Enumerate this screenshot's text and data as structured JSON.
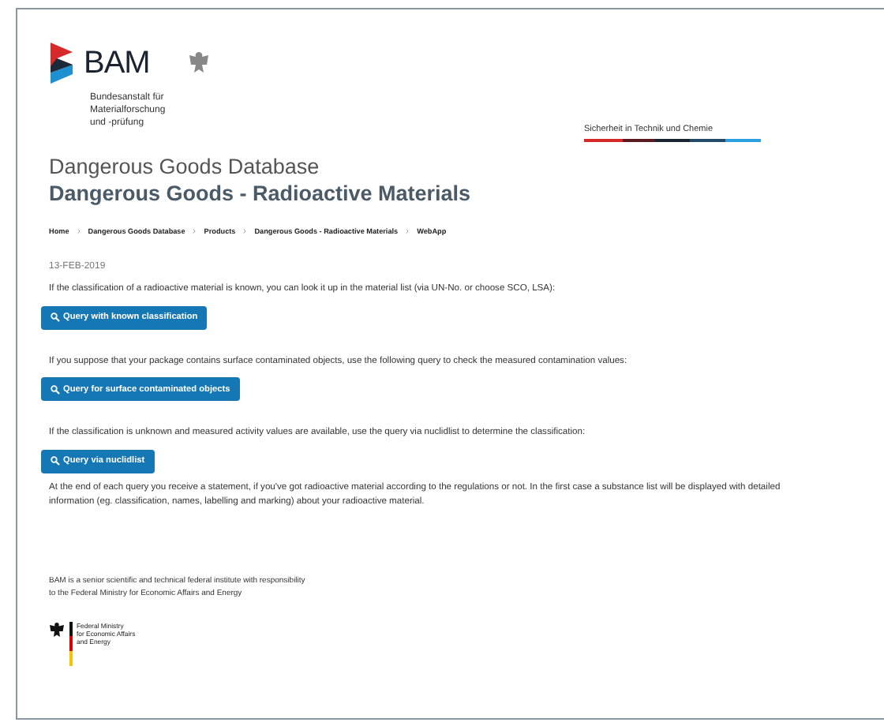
{
  "header": {
    "logo_text": "BAM",
    "logo_subtitle": [
      "Bundesanstalt für",
      "Materialforschung",
      "und -prüfung"
    ],
    "tagline": "Sicherheit in Technik und Chemie"
  },
  "title": "Dangerous Goods Database",
  "subtitle": "Dangerous Goods - Radioactive Materials",
  "breadcrumbs": [
    "Home",
    "Dangerous Goods Database",
    "Products",
    "Dangerous Goods - Radioactive Materials",
    "WebApp"
  ],
  "date": "13-FEB-2019",
  "sections": [
    {
      "text": "If the classification of a radioactive material is known, you can look it up in the material list (via UN-No. or choose SCO, LSA):",
      "button": "Query with known classification"
    },
    {
      "text": "If you suppose that your package contains surface contaminated objects, use the following query to check the measured contamination values:",
      "button": "Query for surface contaminated objects"
    },
    {
      "text": "If the classification is unknown and measured activity values are available, use the query via nuclidlist to determine the classification:",
      "button": "Query via nuclidlist"
    }
  ],
  "closing": "At the end of each query you receive a statement, if you've got radioactive material according to the regulations or not. In the first case a substance list will be displayed with detailed information (eg. classification, names, labelling and marking) about your radioactive material.",
  "footer": {
    "text": [
      "BAM is a senior scientific and technical federal institute with responsibility",
      "to the Federal Ministry for Economic Affairs and Energy"
    ],
    "ministry": [
      "Federal Ministry",
      "for Economic Affairs",
      "and Energy"
    ]
  }
}
